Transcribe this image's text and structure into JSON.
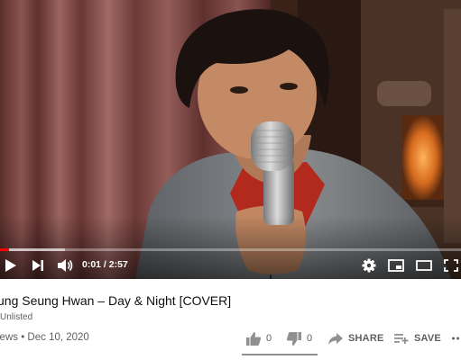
{
  "player": {
    "time_current": "0:01",
    "time_total": "2:57",
    "time_separator": " / ",
    "progress_played_fraction": 0.02,
    "progress_loaded_fraction": 0.14,
    "accent_color": "#ff0000"
  },
  "video": {
    "title": "ung Seung Hwan – Day & Night [COVER]",
    "visibility": "Unlisted",
    "views_text": "iews • Dec 10, 2020"
  },
  "actions": {
    "like_count": "0",
    "dislike_count": "0",
    "share_label": "SHARE",
    "save_label": "SAVE"
  },
  "icons": {
    "play": "play-icon",
    "next": "next-icon",
    "volume": "volume-icon",
    "settings": "gear-icon",
    "miniplayer": "miniplayer-icon",
    "theater": "theater-icon",
    "fullscreen": "fullscreen-icon",
    "like": "thumbs-up-icon",
    "dislike": "thumbs-down-icon",
    "share": "share-icon",
    "save": "playlist-add-icon",
    "more": "more-icon"
  }
}
